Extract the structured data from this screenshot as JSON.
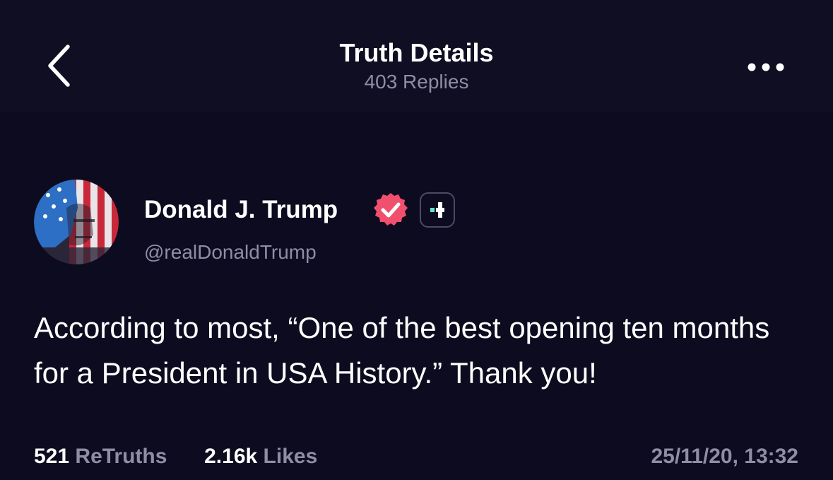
{
  "header": {
    "title": "Truth Details",
    "replies": "403 Replies",
    "back_icon": "chevron-left-icon",
    "more_icon": "ellipsis-icon"
  },
  "post": {
    "author_name": "Donald J. Trump",
    "handle": "@realDonaldTrump",
    "verified_icon": "verified-badge-icon",
    "plus_icon": "plus-badge-icon",
    "text": "According to most, “One of the best opening ten months for a President in USA History.” Thank you!",
    "retruths_count": "521",
    "retruths_label": "ReTruths",
    "likes_count": "2.16k",
    "likes_label": "Likes",
    "timestamp": "25/11/20, 13:32"
  },
  "colors": {
    "background": "#0d0b1f",
    "header_background": "#100e22",
    "muted_text": "#8f8da3",
    "verified_badge": "#f0506e",
    "plus_accent": "#5ae8d2"
  }
}
